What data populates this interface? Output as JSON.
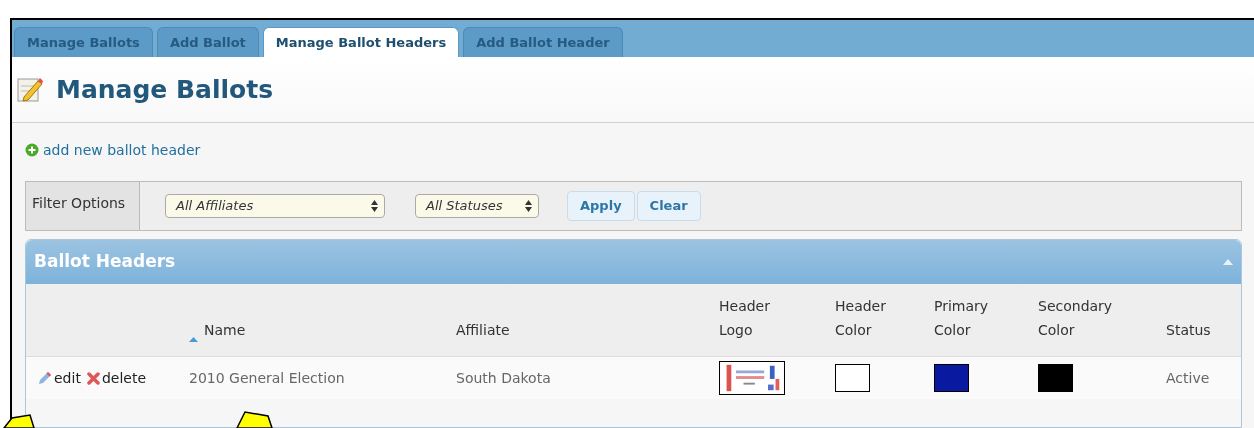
{
  "tabs": [
    {
      "label": "Manage Ballots",
      "selected": false
    },
    {
      "label": "Add Ballot",
      "selected": false
    },
    {
      "label": "Manage Ballot Headers",
      "selected": true
    },
    {
      "label": "Add Ballot Header",
      "selected": false
    }
  ],
  "page_title": "Manage Ballots",
  "add_link": "add new ballot header",
  "filter": {
    "label": "Filter Options",
    "affiliate": "All Affiliates",
    "status": "All Statuses",
    "buttons": [
      "Apply",
      "Clear"
    ]
  },
  "panel": {
    "title": "Ballot Headers",
    "columns": [
      {
        "label": "Name",
        "sorted": true
      },
      {
        "label": "Affiliate",
        "sorted": false
      },
      {
        "label": "Header Logo",
        "sorted": false
      },
      {
        "label": "Header Color",
        "sorted": false
      },
      {
        "label": "Primary Color",
        "sorted": false
      },
      {
        "label": "Secondary Color",
        "sorted": false
      },
      {
        "label": "Status",
        "sorted": false
      }
    ],
    "rows": [
      {
        "actions": [
          "edit",
          "delete"
        ],
        "name": "2010 General Election",
        "affiliate": "South Dakota",
        "header_color": {
          "color": "#ffffff"
        },
        "primary_color": {
          "color": "#0a1aa0"
        },
        "secondary_color": {
          "color": "#000000"
        },
        "status": "Active"
      }
    ]
  }
}
